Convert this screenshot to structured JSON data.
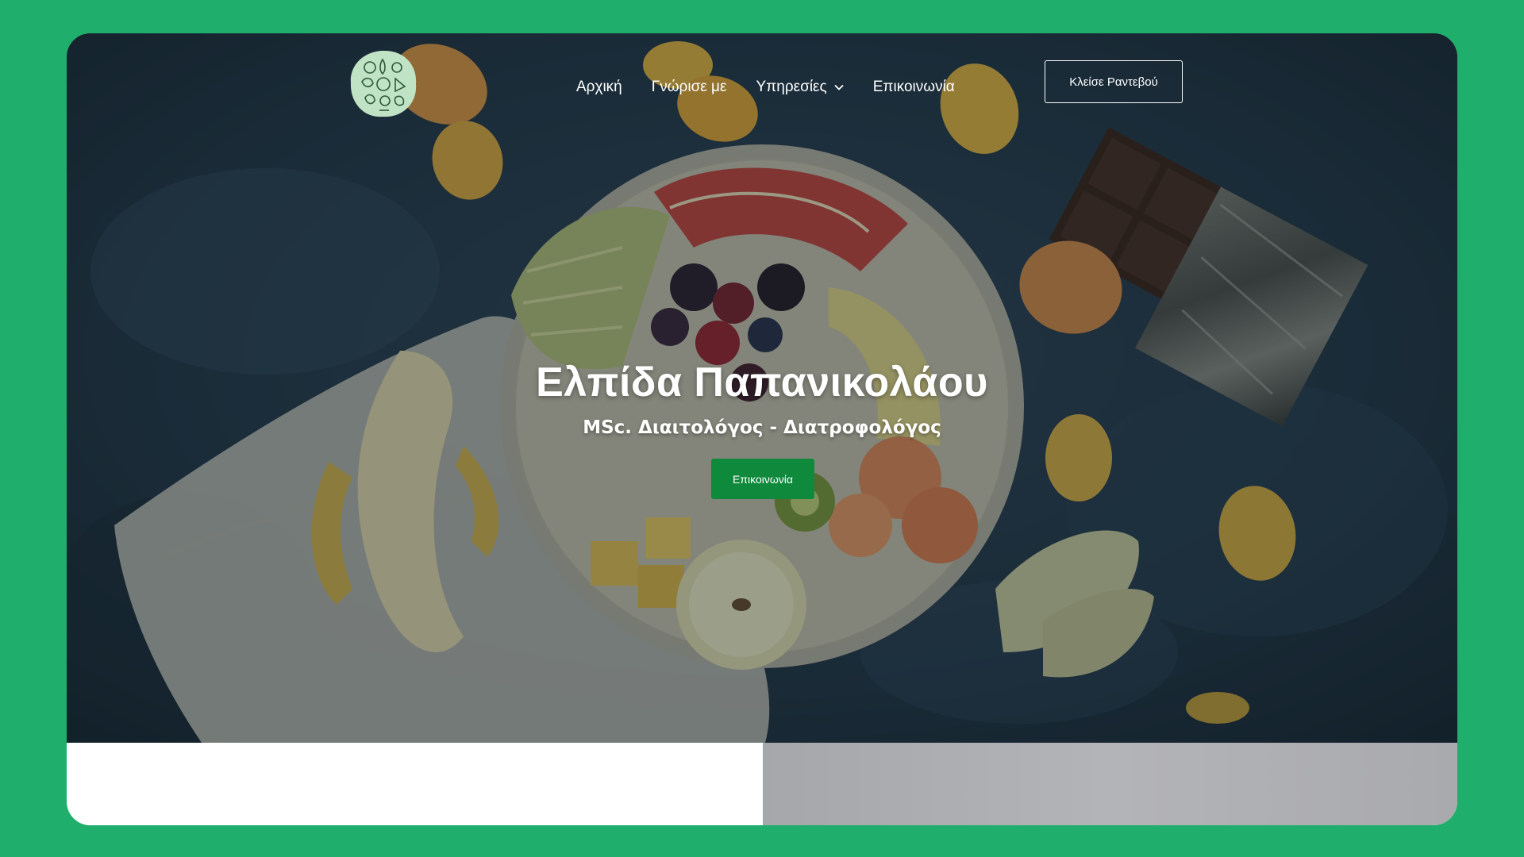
{
  "header": {
    "logo_icon": "fruit-and-vegetable-circle-logo",
    "nav": [
      {
        "label": "Αρχική"
      },
      {
        "label": "Γνώρισε με"
      },
      {
        "label": "Υπηρεσίες",
        "has_dropdown": true
      },
      {
        "label": "Επικοινωνία"
      }
    ],
    "book_button": "Κλείσε Ραντεβού"
  },
  "hero": {
    "title": "Ελπίδα Παπανικολάου",
    "subtitle": "MSc. Διαιτολόγος - Διατροφολόγος",
    "cta": "Επικοινωνία"
  },
  "colors": {
    "page_background": "#1fae6c",
    "cta_button": "#0f8a3c",
    "hero_background": "#1d2b36"
  }
}
